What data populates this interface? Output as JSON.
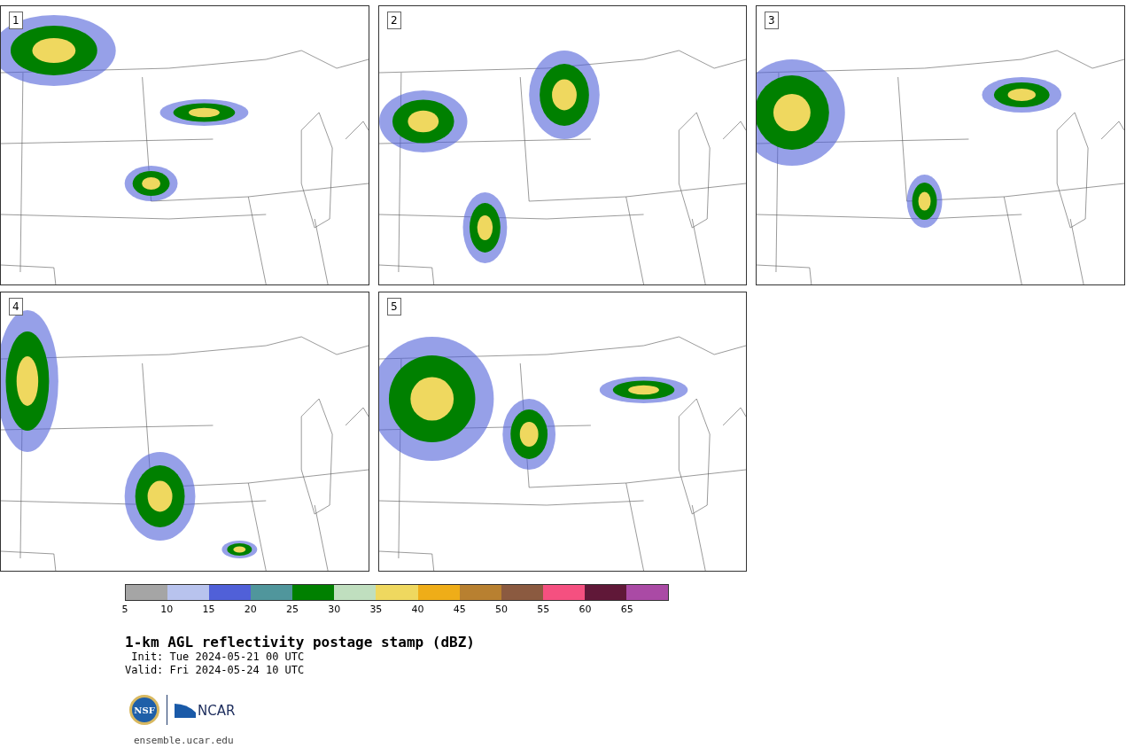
{
  "panels": [
    {
      "label": "1"
    },
    {
      "label": "2"
    },
    {
      "label": "3"
    },
    {
      "label": "4"
    },
    {
      "label": "5"
    }
  ],
  "colorbar": {
    "bins": [
      {
        "color": "#a5a5a5"
      },
      {
        "color": "#b8c3ee"
      },
      {
        "color": "#5060d8"
      },
      {
        "color": "#50969c"
      },
      {
        "color": "#008000"
      },
      {
        "color": "#c0dfbf"
      },
      {
        "color": "#efd85f"
      },
      {
        "color": "#efad18"
      },
      {
        "color": "#b88030"
      },
      {
        "color": "#8b5a40"
      },
      {
        "color": "#f55080"
      },
      {
        "color": "#601838"
      },
      {
        "color": "#aa4aa5"
      }
    ],
    "ticks": [
      "5",
      "10",
      "15",
      "20",
      "25",
      "30",
      "35",
      "40",
      "45",
      "50",
      "55",
      "60",
      "65"
    ]
  },
  "title": "1-km AGL reflectivity postage stamp (dBZ)",
  "init": " Init: Tue 2024-05-21 00 UTC",
  "valid": "Valid: Fri 2024-05-24 10 UTC",
  "logos": {
    "left": "NSF",
    "right": "NCAR"
  },
  "site": "ensemble.ucar.edu"
}
